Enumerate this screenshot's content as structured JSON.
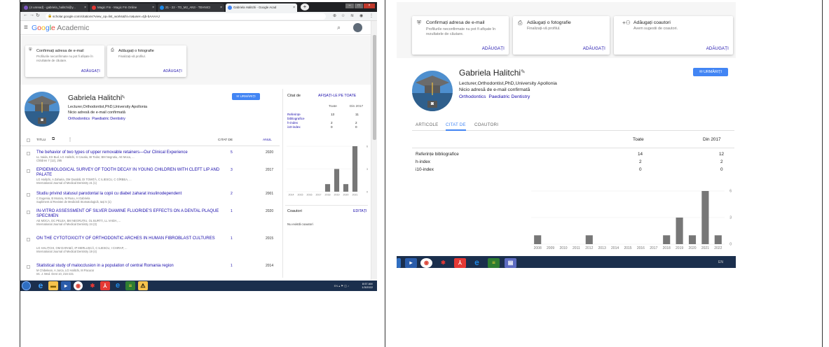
{
  "left": {
    "tabs": [
      {
        "label": "(4 unread) - gabriela_halitchi@y...",
        "color": "#7e57c2"
      },
      {
        "label": "Magic Fm - Magic Fm Online",
        "color": "#e53935"
      },
      {
        "label": "21 - 22 - TD_M2_AN3 - TEHNICI",
        "color": "#1e88e5"
      },
      {
        "label": "Gabriela Halitchi - Google Acad",
        "color": "#4285f4"
      }
    ],
    "url": "scholar.google.com/citations?view_op=list_works&hl=ro&user=4jb-bAAAAJ",
    "brand": "Google Academic",
    "cards": [
      {
        "icon": "verified-user-icon",
        "title": "Confirmați adresa de e-mail",
        "desc": "Profilurile neconfirmate nu pot fi afișate în rezultatele de căutare.",
        "action": "ADĂUGAȚI"
      },
      {
        "icon": "add-photo-icon",
        "title": "Adăugați o fotografie",
        "desc": "Finalizați-vă profilul.",
        "action": "ADĂUGAȚI"
      }
    ],
    "profile": {
      "name": "Gabriela Halitchi",
      "affiliation": "Lecturer,Orthodontist,PhD,University Apollonia",
      "email": "Nicio adresă de e-mail confirmată",
      "tags": [
        "Orthodontics",
        "Paediatric Dentistry"
      ],
      "follow": "URMĂRIȚI"
    },
    "list_headers": {
      "title": "TITLU",
      "cited": "CITAT DE",
      "year": "ANUL"
    },
    "articles": [
      {
        "title": "The behavior of two types of upper removable retainers—Our Clinical Experience",
        "authors": "LL Vaida, ES Bud, LG Halitchi, S Cavalu, BI Todor, BM Negrutiu, AE Moca, ...",
        "source": "Children 7 (12), 295",
        "cited": "5",
        "year": "2020"
      },
      {
        "title": "EPIDEMIOLOGICAL SURVEY OF TOOTH DECAY IN YOUNG CHILDREN WITH CLEFT LIP AND PALATE",
        "authors": "LG Halițchi, A Zaharia, OM Darabă, DI TOMIȚĂ, C ILIESCU, C GÎRBEA, ...",
        "source": "International Journal of Medical Dentistry 21 (1)",
        "cited": "3",
        "year": "2017"
      },
      {
        "title": "Studiu privind statusul parodontal la copii cu diabet zaharat insulinodependent",
        "authors": "C Eugenia, B Moraru, M Rusu, H Gabriela",
        "source": "Supliment al Revistei de Medicină Stomatologică, Iași 5 (1)",
        "cited": "2",
        "year": "2001"
      },
      {
        "title": "IN-VITRO ASSESSMENT OF SILVER DIAMINE FLUORIDE'S EFFECTS ON A DENTAL PLAQUE SPECIMEN",
        "authors": "AE MOCA, DC PELEA, BM NEGRUȚIU, OL BURTĂ, LL VAIDA, ...",
        "source": "International Journal of Medical Dentistry 24 (3)",
        "cited": "1",
        "year": "2020"
      },
      {
        "title": "ON THE CYTOTOXICITY OF ORTHODONTIC ARCHES IN HUMAN FIBROBLAST CULTURES",
        "authors": "LG HALIȚCHI, OM DARABĂ, IP MERLUȘCĂ, C ILIESCU, I CHIRAP, ...",
        "source": "International Journal of Medical Dentistry 19 (4)",
        "cited": "1",
        "year": "2015"
      },
      {
        "title": "Statistical study of malocclusion in a population of central Romania region",
        "authors": "M Chibelean, A Jurca, LG Halitchi, M Pacurar",
        "source": "Int. J. Med. Dent 10, 216-221",
        "cited": "1",
        "year": "2014"
      }
    ],
    "cited_by": {
      "title": "Citat de",
      "view_all": "AFIȘAȚI-LE PE TOATE",
      "col_all": "Toate",
      "col_since": "Din 2017",
      "rows": [
        {
          "label": "Referințe bibliografice",
          "all": "13",
          "since": "11"
        },
        {
          "label": "h-index",
          "all": "2",
          "since": "2"
        },
        {
          "label": "i10-index",
          "all": "0",
          "since": "0"
        }
      ]
    },
    "coauthors": {
      "title": "Coautori",
      "edit": "EDITAȚI",
      "empty": "Nu există coautori"
    },
    "clock": {
      "time": "8:57 AM",
      "date": "1/3/2022",
      "lang": "EN"
    }
  },
  "right": {
    "cards": [
      {
        "icon": "verified-user-icon",
        "title": "Confirmați adresa de e-mail",
        "desc": "Profilurile neconfirmate nu pot fi afișate în rezultatele de căutare.",
        "action": "ADĂUGAȚI"
      },
      {
        "icon": "add-photo-icon",
        "title": "Adăugați o fotografie",
        "desc": "Finalizați-vă profilul.",
        "action": "ADĂUGAȚI"
      },
      {
        "icon": "person-add-icon",
        "title": "Adăugați coautori",
        "desc": "Avem sugestii de coautori.",
        "action": "ADĂUGAȚI"
      }
    ],
    "profile": {
      "name": "Gabriela Halitchi",
      "affiliation": "Lecturer,Orthodontist,PhD,University Apollonia",
      "email": "Nicio adresă de e-mail confirmată",
      "tags": [
        "Orthodontics",
        "Paediatric Dentistry"
      ],
      "follow": "URMĂRIȚI"
    },
    "tabs": [
      "ARTICOLE",
      "CITAT DE",
      "COAUTORI"
    ],
    "table": {
      "col_all": "Toate",
      "col_since": "Din 2017",
      "rows": [
        {
          "label": "Referințe bibliografice",
          "all": "14",
          "since": "12"
        },
        {
          "label": "h-index",
          "all": "2",
          "since": "2"
        },
        {
          "label": "i10-index",
          "all": "0",
          "since": "0"
        }
      ]
    },
    "lang": "EN"
  },
  "chart_data": [
    {
      "type": "bar",
      "categories": [
        "2014",
        "2015",
        "2016",
        "2017",
        "2018",
        "2019",
        "2020",
        "2021"
      ],
      "values": [
        0,
        0,
        0,
        0,
        1,
        3,
        1,
        6
      ],
      "ylim": [
        0,
        6
      ],
      "yticks": [
        "0",
        "3",
        "6"
      ],
      "color": "#777777"
    },
    {
      "type": "bar",
      "categories": [
        "2008",
        "2009",
        "2010",
        "2011",
        "2012",
        "2013",
        "2014",
        "2015",
        "2016",
        "2017",
        "2018",
        "2019",
        "2020",
        "2021",
        "2022"
      ],
      "values": [
        1,
        0,
        0,
        0,
        1,
        0,
        0,
        0,
        0,
        0,
        1,
        3,
        1,
        6,
        1
      ],
      "ylim": [
        0,
        6
      ],
      "yticks": [
        "0",
        "3",
        "6"
      ],
      "color": "#777777"
    }
  ]
}
